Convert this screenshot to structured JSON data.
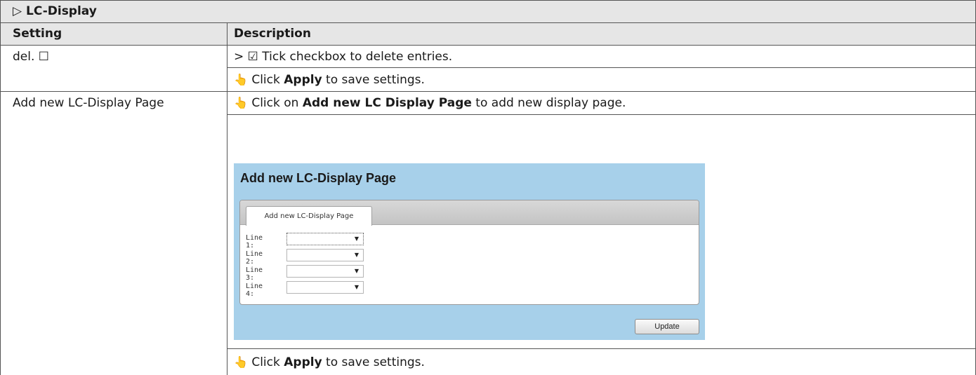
{
  "section": {
    "glyph": "▷",
    "title": "LC-Display"
  },
  "columns": {
    "setting": "Setting",
    "description": "Description"
  },
  "rows": [
    {
      "setting": "del. ☐",
      "lines": [
        {
          "prefix": "> ☑ ",
          "text": "Tick checkbox to delete entries."
        },
        {
          "glyph": "👆",
          "before": " Click ",
          "bold": "Apply",
          "after": " to save settings."
        }
      ]
    },
    {
      "setting": "Add new LC-Display Page",
      "lines": [
        {
          "glyph": "👆",
          "before": " Click on ",
          "bold": "Add new LC Display Page",
          "after": " to add new display page."
        },
        {
          "glyph": "👆",
          "before": " Click ",
          "bold": "Apply",
          "after": " to save settings."
        }
      ]
    }
  ],
  "screenshot": {
    "title": "Add new LC-Display Page",
    "tab": "Add new LC-Display Page",
    "fields": [
      {
        "label": "Line 1:",
        "value": ""
      },
      {
        "label": "Line 2:",
        "value": ""
      },
      {
        "label": "Line 3:",
        "value": ""
      },
      {
        "label": "Line 4:",
        "value": ""
      }
    ],
    "button": "Update"
  },
  "icons": {
    "hand": "hand-pointer-icon",
    "dropdown": "chevron-down-icon"
  },
  "colors": {
    "header_band": "#e6e6e6",
    "screenshot_bg": "#a7d0ea"
  }
}
